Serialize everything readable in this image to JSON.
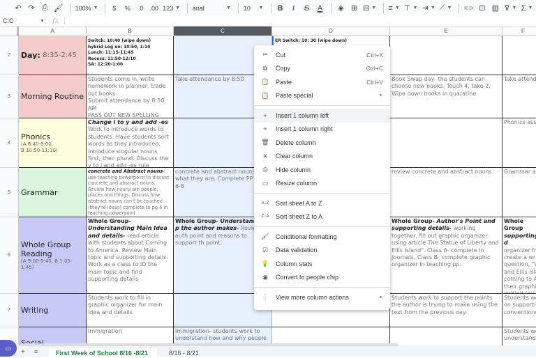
{
  "toolbar": {
    "undo": "↶",
    "redo": "↷",
    "print": "⎙",
    "paint_format": "🖌",
    "zoom": "100%",
    "currency": "$",
    "percent": "%",
    "dec_decrease": ".0",
    "dec_increase": ".00",
    "more_formats": "123",
    "font": "arial",
    "font_size": "10",
    "bold": "B",
    "italic": "I",
    "strike": "S",
    "text_color": "A",
    "fill": "◈",
    "borders": "⊞",
    "merge": "⊟",
    "align": "≡",
    "valign": "⊤",
    "wrap": "⇥",
    "rotate": "⟋",
    "link": "⊂⊃",
    "comment": "⊡",
    "chart": "▥",
    "filter": "⊽",
    "functions": "Σ"
  },
  "formula_bar": {
    "name_box": "C:C",
    "fx": "fx",
    "value": ""
  },
  "columns": [
    "A",
    "B",
    "C",
    "D",
    "E",
    "F"
  ],
  "selected_column": "C",
  "rows": [
    {
      "num": "2",
      "a": {
        "title": "Day:",
        "subtitle_inline": "8:35-2:45",
        "bg": "#f4cccc"
      },
      "b_lines": [
        "Switch: 10:40 (wipe down)",
        "hybrid Log on: 10:50, 1:10",
        "Lunch: 11:15-11:45",
        "Recess: 11:50-12:10",
        "SA: 12:20-1:00"
      ],
      "c": "",
      "d": "ER Switch: 10: 30 (wipe down)",
      "e": "",
      "f": ""
    },
    {
      "num": "3",
      "a": {
        "title": "Morning Routine",
        "bg": "#f4cccc"
      },
      "b": "Students come in, write homework in planner, trade out books\nSubmit attendance by 8:50 AM\nPASS OUT NEW SPELLING MENU",
      "c": "Take attendance by 8:50",
      "d": "",
      "e": "Book Swap day- the students can choose new books. Touch 4, take 2. Wipe down books in quaratine",
      "f": "Take attendo"
    },
    {
      "num": "4",
      "a": {
        "title": "Phonics",
        "sub": "(A 8:40-9:00,\nB 10:50-11:10)",
        "bg": "#ffffdd"
      },
      "b_head": "Change i to y and add -es",
      "b": "Work to introduce words to students. Have students sort words as they introduced. Introduce singular nouns first, then plural. Discuss the y to i and add -es rule",
      "c": "",
      "d": "",
      "e": "",
      "f": "Phonics asse"
    },
    {
      "num": "5",
      "a": {
        "title": "Grammar",
        "bg": "#d9f5dd"
      },
      "b_head": "concrete and Abstract nouns-",
      "b": " use teaching powerpoint to discuss concrete and abstract nouns. Review how nouns are people, places and things. Discuss how abstract nouns can't be touched (they're ideas) complete to pg 6 in teaching powerpoint",
      "c": "concrete and abstract nouns- r what they are. Complete PP slic 6-8",
      "d": "",
      "e": "review concrete and abstract nouns",
      "f": "Grammar as"
    },
    {
      "num": "6",
      "a": {
        "title": "Whole Group Reading",
        "sub": "(A 9:00-9:40, B 1:05-1:45)",
        "bg": "#c9c9f7"
      },
      "b_bold": "Whole Group- ",
      "b_head": "Understanding Main Idea and details-",
      "b": " read article with students about Coming to America. Review Main topic and supporting details. Work as a class to ID the main topic and find supporting details",
      "c_bold": "Whole Group- ",
      "c_head": "Understanding p the author makes-",
      "c": " Review auth point and reasons to support th point.",
      "d": "",
      "e_bold": "Whole Group- ",
      "e_head": "Author's Point and supporting details-",
      "e": " working together, fill out graphic organizer using article The Statue of Liberty and Ellis Island\". Class A- complete in Journals, Class B- complete graphic organizer in teaching pp.",
      "f_bold": "Whole Group",
      "f_head": "supporting d",
      "f": "organizer fro create a writ question, \"W and Ellis Isla coming to Ar their graphic writing (guid"
    },
    {
      "num": "7",
      "a": {
        "title": "Writing",
        "bg": "#c9c9f7"
      },
      "b": "Students work to fill in graphic organizer for main idea and details",
      "c": "",
      "d": "",
      "e": "Students work to support the points the author is trying to make using the text from the previous day.",
      "f": "Students wo on supportin conventions."
    },
    {
      "num": "8",
      "a": {
        "title": "Social",
        "bg": "#c9c9f7"
      },
      "b": "Immigration",
      "c": "Immigration- students work to understand how and why people",
      "d": "",
      "e": "",
      "f": "Students wo understand i"
    }
  ],
  "context_menu": {
    "groups": [
      [
        {
          "icon": "✂",
          "icon_name": "cut-icon",
          "label": "Cut",
          "shortcut": "Ctrl+X"
        },
        {
          "icon": "⧉",
          "icon_name": "copy-icon",
          "label": "Copy",
          "shortcut": "Ctrl+C"
        },
        {
          "icon": "📋",
          "icon_name": "paste-icon",
          "label": "Paste",
          "shortcut": "Ctrl+V"
        },
        {
          "icon": "📋",
          "icon_name": "paste-special-icon",
          "label": "Paste special",
          "submenu": "►"
        }
      ],
      [
        {
          "icon": "+",
          "icon_name": "plus-icon",
          "label": "Insert 1 column left",
          "highlighted": true
        },
        {
          "icon": "+",
          "icon_name": "plus-icon",
          "label": "Insert 1 column right"
        },
        {
          "icon": "🗑",
          "icon_name": "trash-icon",
          "label": "Delete column"
        },
        {
          "icon": "✕",
          "icon_name": "close-icon",
          "label": "Clear column"
        },
        {
          "icon": "◎",
          "icon_name": "eye-off-icon",
          "label": "Hide column"
        },
        {
          "icon": "▭",
          "icon_name": "resize-icon",
          "label": "Resize column"
        }
      ],
      [
        {
          "icon": "A↓Z",
          "icon_name": "sort-az-icon",
          "label": "Sort sheet A to Z"
        },
        {
          "icon": "Z↓A",
          "icon_name": "sort-za-icon",
          "label": "Sort sheet Z to A"
        }
      ],
      [
        {
          "icon": "🖌",
          "icon_name": "paint-roller-icon",
          "label": "Conditional formatting"
        },
        {
          "icon": "☑",
          "icon_name": "data-validation-icon",
          "label": "Data validation"
        },
        {
          "icon": "💡",
          "icon_name": "lightbulb-icon",
          "label": "Column stats"
        },
        {
          "icon": "◉",
          "icon_name": "person-chip-icon",
          "label": "Convert to people chip"
        }
      ],
      [
        {
          "icon": "⋮",
          "icon_name": "more-vert-icon",
          "label": "View more column actions",
          "submenu": "►"
        }
      ]
    ]
  },
  "sheets": {
    "add": "+",
    "all": "≡",
    "tabs": [
      "First Week of School 8/16 -8/21",
      "8/16 - 8/21"
    ]
  },
  "meet_icon": "▭"
}
